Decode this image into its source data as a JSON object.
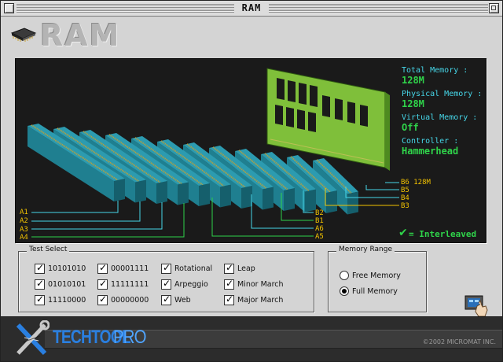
{
  "window": {
    "title": "RAM"
  },
  "header": {
    "title": "RAM",
    "icon": "memory-chip-icon"
  },
  "display": {
    "info": [
      {
        "label": "Total Memory :",
        "value": "128M"
      },
      {
        "label": "Physical Memory :",
        "value": "128M"
      },
      {
        "label": "Virtual Memory :",
        "value": "Off"
      },
      {
        "label": "Controller :",
        "value": "Hammerhead"
      }
    ],
    "left_banks": [
      "A1",
      "A2",
      "A3",
      "A4"
    ],
    "right_banks": [
      "B6 128M",
      "B5",
      "B4",
      "B3",
      "B2",
      "B1",
      "A6",
      "A5"
    ],
    "mode": "= Interleaved",
    "colors": {
      "background": "#1a1a1a",
      "label_cyan": "#46d6e8",
      "value_green": "#2fd34a",
      "bank_yellow": "#f2c200",
      "slot_teal": "#1f7f90",
      "dimm_green": "#7fbf3a"
    }
  },
  "test_select": {
    "title": "Test Select",
    "options": [
      {
        "label": "10101010",
        "checked": true
      },
      {
        "label": "01010101",
        "checked": true
      },
      {
        "label": "11110000",
        "checked": true
      },
      {
        "label": "00001111",
        "checked": true
      },
      {
        "label": "11111111",
        "checked": true
      },
      {
        "label": "00000000",
        "checked": true
      },
      {
        "label": "Rotational",
        "checked": true
      },
      {
        "label": "Arpeggio",
        "checked": true
      },
      {
        "label": "Web",
        "checked": true
      },
      {
        "label": "Leap",
        "checked": true
      },
      {
        "label": "Minor March",
        "checked": true
      },
      {
        "label": "Major March",
        "checked": true
      }
    ]
  },
  "memory_range": {
    "title": "Memory Range",
    "options": [
      {
        "label": "Free Memory",
        "selected": false
      },
      {
        "label": "Full Memory",
        "selected": true
      }
    ]
  },
  "footer": {
    "brand_tool": "TECHTOOL",
    "brand_pro": "PRO",
    "copyright": "©2002 MICROMAT INC."
  }
}
